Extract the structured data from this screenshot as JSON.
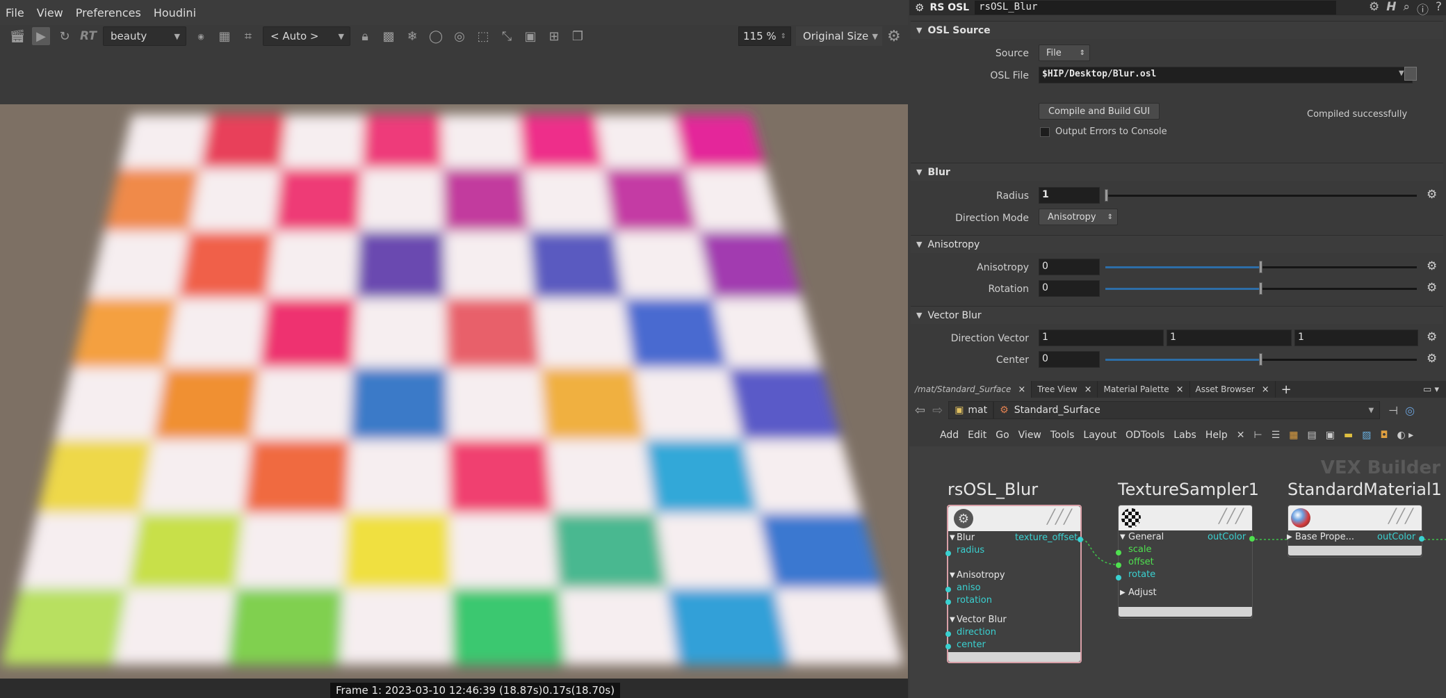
{
  "menu": [
    "File",
    "View",
    "Preferences",
    "Houdini"
  ],
  "toolbar": {
    "rt_label": "RT",
    "aov": "beauty",
    "camera": "< Auto >",
    "zoom": "115 %",
    "size_mode": "Original Size"
  },
  "render": {
    "status": "Frame  1:  2023-03-10  12:46:39  (18.87s)0.17s(18.70s)",
    "grid_colors": [
      [
        "#f6eef0",
        "#e8405a",
        "#f6eef0",
        "#ee3a7a",
        "#f6eef0",
        "#ee2f8a",
        "#f6eef0",
        "#e4289a"
      ],
      [
        "#f08a4a",
        "#f6eef0",
        "#ee3a76",
        "#f6eef0",
        "#c23a9e",
        "#f6eef0",
        "#c43aa4",
        "#f6eef0"
      ],
      [
        "#f6eef0",
        "#f0604a",
        "#f6eef0",
        "#6a4ab0",
        "#f6eef0",
        "#5a5ac0",
        "#f6eef0",
        "#a23ab0"
      ],
      [
        "#f4a040",
        "#f6eef0",
        "#ee3070",
        "#f6eef0",
        "#e8606a",
        "#f6eef0",
        "#4a6ad0",
        "#f6eef0"
      ],
      [
        "#f6eef0",
        "#f09030",
        "#f6eef0",
        "#3a7ac8",
        "#f6eef0",
        "#f0b040",
        "#f6eef0",
        "#5a5ac8"
      ],
      [
        "#eed84a",
        "#f6eef0",
        "#f06a40",
        "#f6eef0",
        "#f04070",
        "#f6eef0",
        "#30a8d8",
        "#f6eef0"
      ],
      [
        "#f6eef0",
        "#c8e04a",
        "#f6eef0",
        "#f0e040",
        "#f6eef0",
        "#4ab890",
        "#f6eef0",
        "#3a78d0"
      ],
      [
        "#b8e060",
        "#f6eef0",
        "#80d050",
        "#f6eef0",
        "#3ac870",
        "#f6eef0",
        "#30a0d8",
        "#f6eef0"
      ]
    ]
  },
  "params": {
    "node_type": "RS OSL",
    "node_name": "rsOSL_Blur",
    "osl_source": {
      "title": "OSL Source",
      "source_label": "Source",
      "source_value": "File",
      "oslfile_label": "OSL File",
      "oslfile_value": "$HIP/Desktop/Blur.osl",
      "compile_button": "Compile and Build GUI",
      "compile_status": "Compiled successfully",
      "errors_label": "Output Errors to Console"
    },
    "blur": {
      "title": "Blur",
      "radius_label": "Radius",
      "radius_value": "1",
      "direction_mode_label": "Direction Mode",
      "direction_mode_value": "Anisotropy"
    },
    "anisotropy": {
      "title": "Anisotropy",
      "aniso_label": "Anisotropy",
      "aniso_value": "0",
      "rotation_label": "Rotation",
      "rotation_value": "0"
    },
    "vector_blur": {
      "title": "Vector Blur",
      "direction_label": "Direction Vector",
      "direction_values": [
        "1",
        "1",
        "1"
      ],
      "center_label": "Center",
      "center_value": "0"
    }
  },
  "network": {
    "tabs": [
      {
        "label": "/mat/Standard_Surface",
        "active": true
      },
      {
        "label": "Tree View"
      },
      {
        "label": "Material Palette"
      },
      {
        "label": "Asset Browser"
      }
    ],
    "path": [
      "mat",
      "Standard_Surface"
    ],
    "menu": [
      "Add",
      "Edit",
      "Go",
      "View",
      "Tools",
      "Layout",
      "ODTools",
      "Labs",
      "Help"
    ],
    "context_label": "VEX Builder",
    "nodes": {
      "blur": {
        "name": "rsOSL_Blur",
        "sections": [
          "Blur",
          "Anisotropy",
          "Vector Blur"
        ],
        "inputs": [
          "radius",
          "aniso",
          "rotation",
          "direction",
          "center"
        ],
        "output": "texture_offset"
      },
      "sampler": {
        "name": "TextureSampler1",
        "section": "General",
        "inputs": [
          "scale",
          "offset",
          "rotate"
        ],
        "collapsed": "Adjust",
        "output": "outColor"
      },
      "material": {
        "name": "StandardMaterial1",
        "section": "Base Prope...",
        "output": "outColor"
      }
    }
  }
}
